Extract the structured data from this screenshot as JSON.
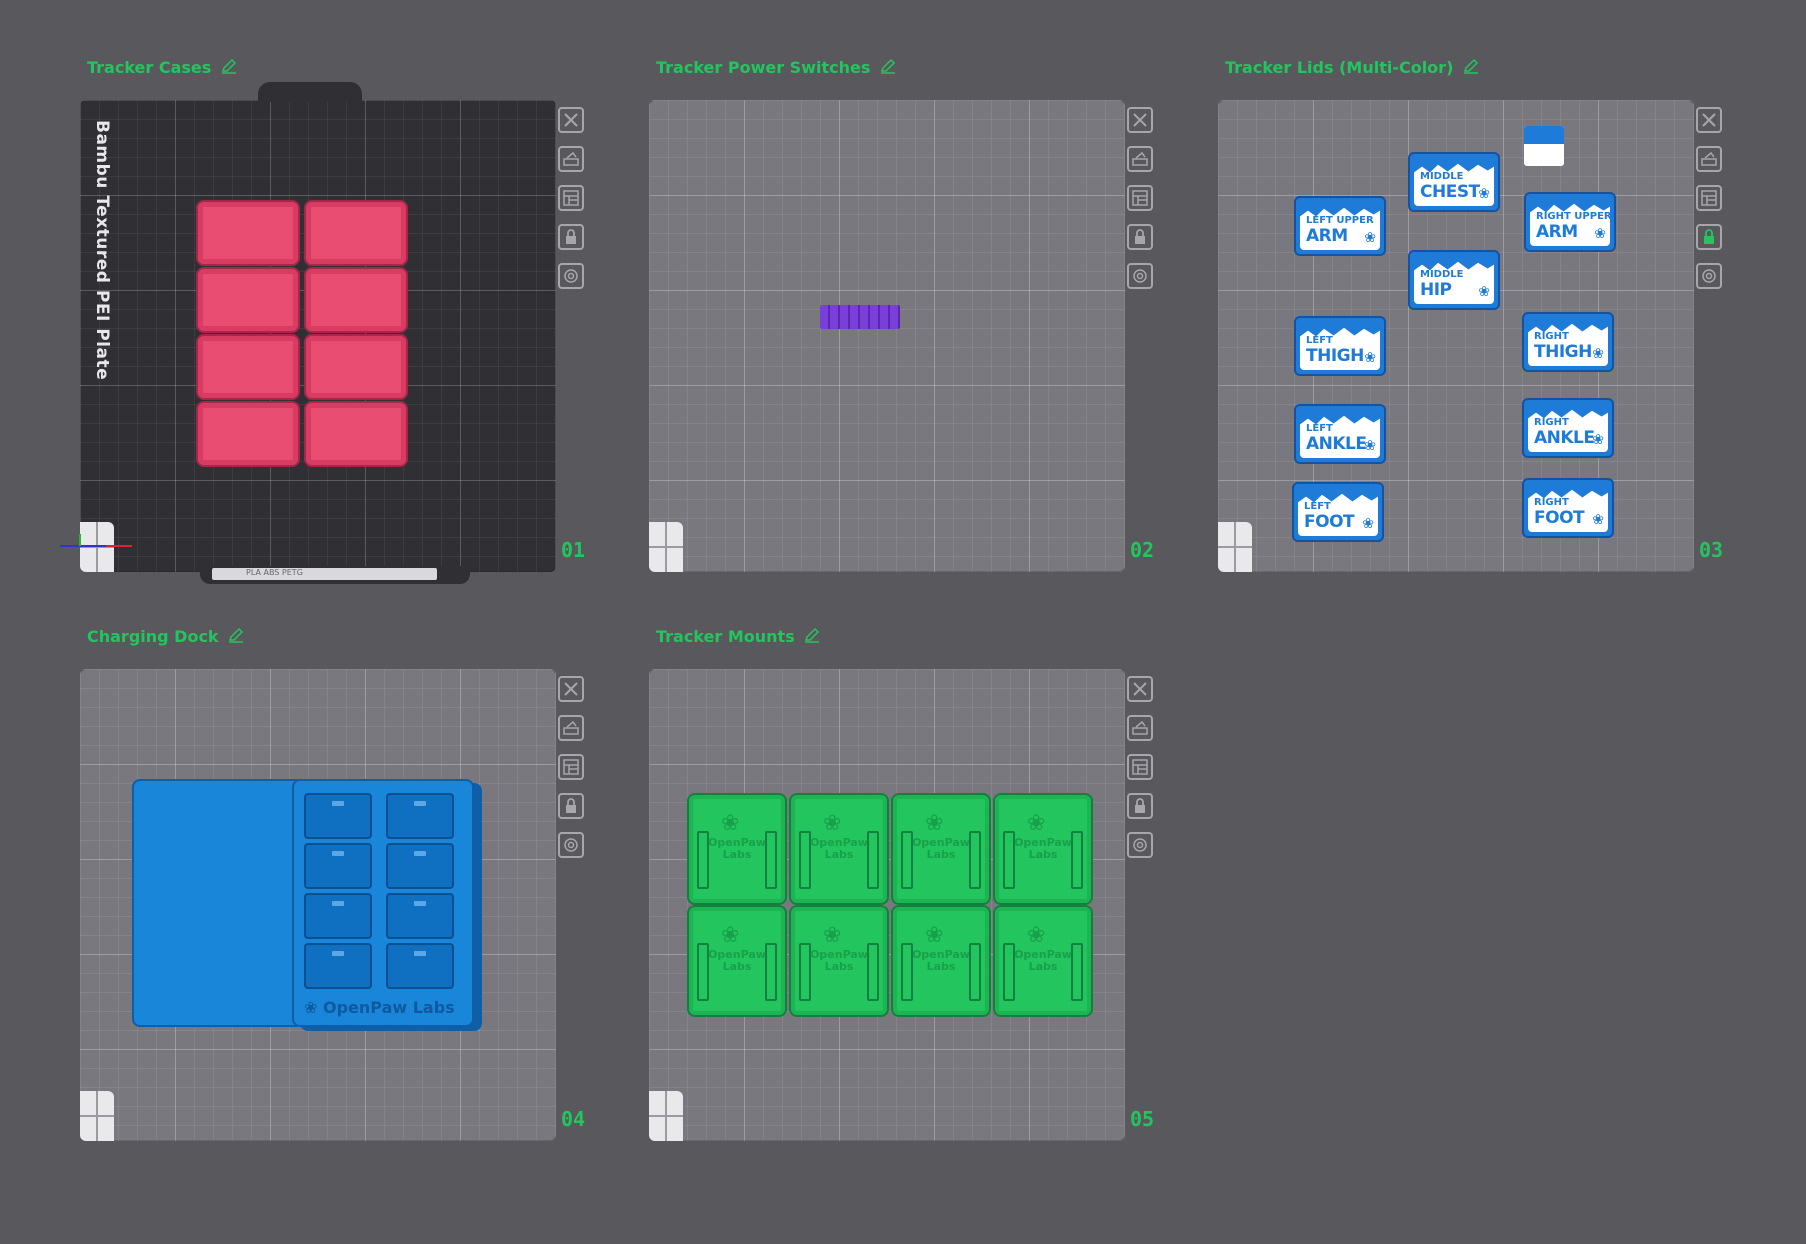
{
  "plates": [
    {
      "title": "Tracker Cases",
      "number": "01",
      "bed_label": "Bambu Textured PEI Plate",
      "bed_strip": "PLA ABS PETG"
    },
    {
      "title": "Tracker Power Switches",
      "number": "02"
    },
    {
      "title": "Tracker Lids (Multi-Color)",
      "number": "03"
    },
    {
      "title": "Charging Dock",
      "number": "04",
      "brand": "OpenPaw Labs"
    },
    {
      "title": "Tracker Mounts",
      "number": "05",
      "mount_text_1": "OpenPaw",
      "mount_text_2": "Labs"
    }
  ],
  "lids": [
    {
      "line1": "MIDDLE",
      "line2": "CHEST"
    },
    {
      "line1": "LEFT UPPER",
      "line2": "ARM"
    },
    {
      "line1": "RIGHT UPPER",
      "line2": "ARM"
    },
    {
      "line1": "MIDDLE",
      "line2": "HIP"
    },
    {
      "line1": "LEFT",
      "line2": "THIGH"
    },
    {
      "line1": "RIGHT",
      "line2": "THIGH"
    },
    {
      "line1": "LEFT",
      "line2": "ANKLE"
    },
    {
      "line1": "RIGHT",
      "line2": "ANKLE"
    },
    {
      "line1": "LEFT",
      "line2": "FOOT"
    },
    {
      "line1": "RIGHT",
      "line2": "FOOT"
    }
  ],
  "toolbar_icons": [
    "close-icon",
    "auto-orient-icon",
    "arrange-icon",
    "lock-icon",
    "settings-icon"
  ],
  "colors": {
    "accent_green": "#22c55e",
    "case_pink": "#e94e72",
    "switch_purple": "#7b3fd9",
    "lid_blue": "#1f7bd8",
    "dock_blue": "#1a86d9",
    "mount_green": "#22c55e",
    "background": "#59595d"
  }
}
